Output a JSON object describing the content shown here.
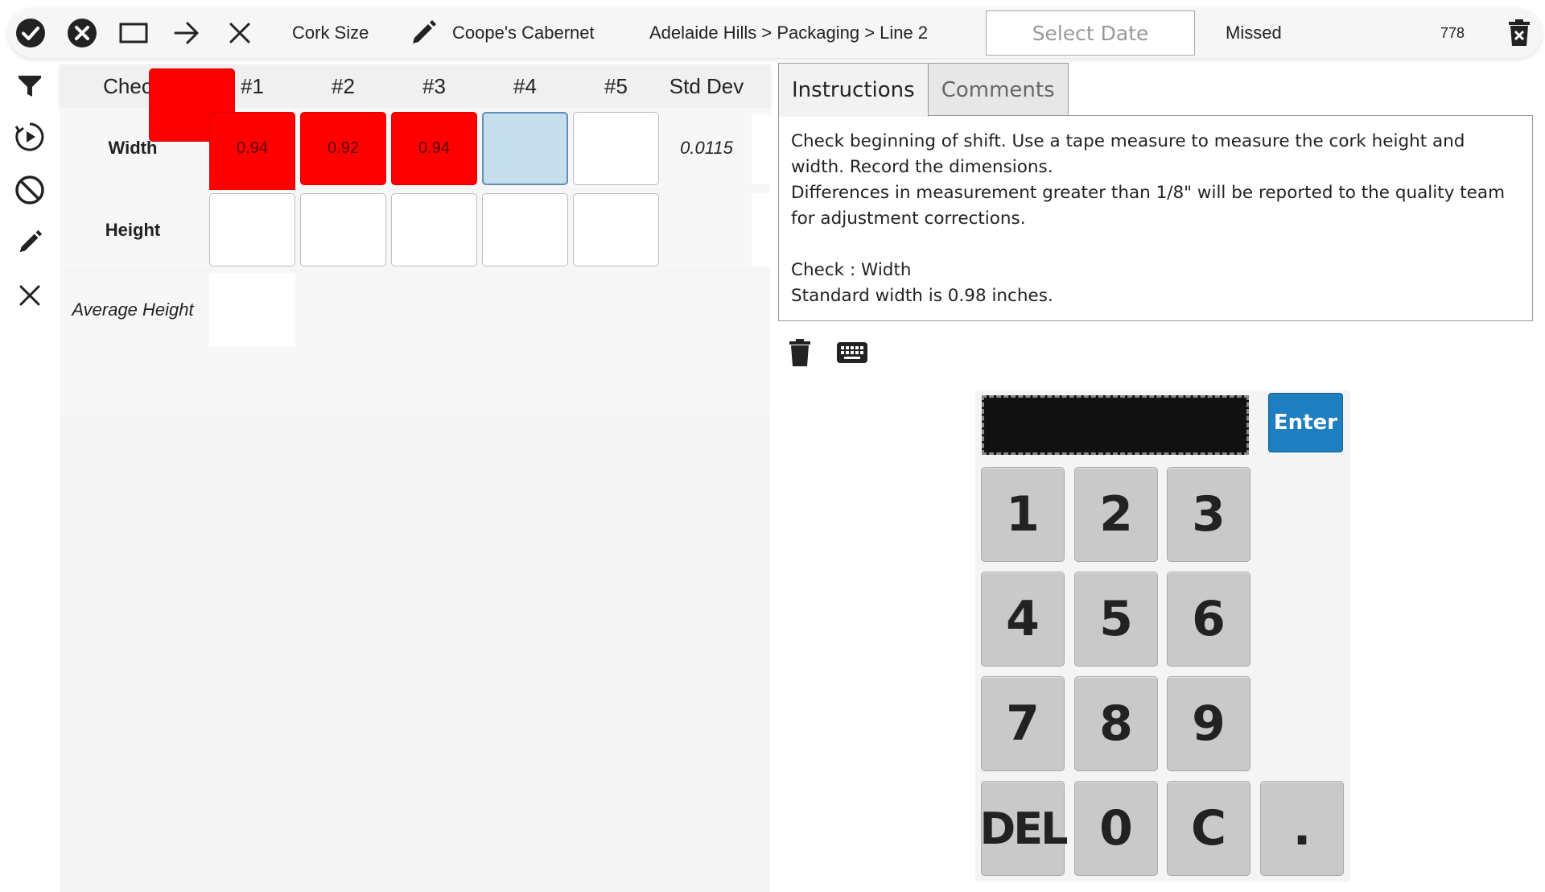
{
  "toolbar": {
    "check_name": "Cork Size",
    "product": "Coope's Cabernet",
    "breadcrumb": "Adelaide Hills > Packaging > Line 2",
    "date_placeholder": "Select Date",
    "status": "Missed",
    "count": "778"
  },
  "grid": {
    "columns": [
      "Check",
      "#1",
      "#2",
      "#3",
      "#4",
      "#5",
      "Std Dev"
    ],
    "rows": [
      {
        "label": "Width",
        "values": [
          "0.94",
          "0.92",
          "0.94",
          "",
          ""
        ],
        "std_dev": "0.0115"
      },
      {
        "label": "Height",
        "values": [
          "",
          "",
          "",
          "",
          ""
        ],
        "std_dev": ""
      }
    ],
    "average_label": "Average Height",
    "out_of_spec_color": "#ff0000",
    "active_cell_color": "#c6ddec"
  },
  "tabs": {
    "instructions": "Instructions",
    "comments": "Comments"
  },
  "instructions": {
    "line1": "Check beginning of shift. Use a tape measure to measure the cork height and width. Record the dimensions.",
    "line2": "Differences in measurement greater than 1/8\" will be reported to the quality team for adjustment corrections.",
    "line3": "Check : Width",
    "line4": "Standard width is 0.98 inches."
  },
  "keypad": {
    "display": "",
    "enter": "Enter",
    "keys": [
      "1",
      "2",
      "3",
      "4",
      "5",
      "6",
      "7",
      "8",
      "9",
      "DEL",
      "0",
      "C",
      "."
    ],
    "enter_color": "#1e7fc0"
  },
  "icons": {
    "toolbar": [
      "check-circle-icon",
      "close-circle-icon",
      "square-icon",
      "arrow-right-icon",
      "close-icon",
      "pencil-icon",
      "delete-bin-icon"
    ],
    "sidebar": [
      "filter-icon",
      "history-icon",
      "block-icon",
      "pencil-icon",
      "close-icon"
    ],
    "panel": [
      "trash-icon",
      "keyboard-icon"
    ]
  }
}
